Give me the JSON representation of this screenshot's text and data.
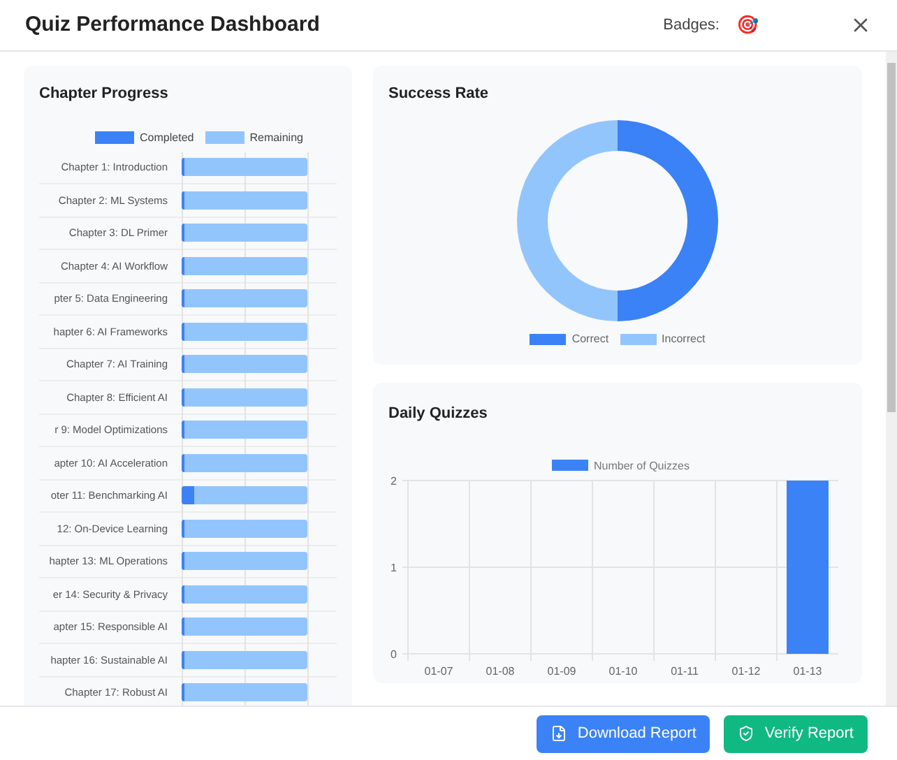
{
  "window": {
    "title": "Quiz Performance Dashboard",
    "badges_label": "Badges:",
    "badges": [
      "🎯"
    ]
  },
  "chapter_progress": {
    "title": "Chapter Progress",
    "legend": [
      {
        "label": "Completed",
        "color": "#3b82f6"
      },
      {
        "label": "Remaining",
        "color": "#93c5fd"
      }
    ],
    "chapters": [
      {
        "label": "Chapter 1: Introduction",
        "level": 0.02
      },
      {
        "label": "Chapter 2: ML Systems",
        "level": 0.02
      },
      {
        "label": "Chapter 3: DL Primer",
        "level": 0.02
      },
      {
        "label": "Chapter 4: AI Workflow",
        "level": 0.02
      },
      {
        "label": "pter 5: Data Engineering",
        "level": 0.02
      },
      {
        "label": "hapter 6: AI Frameworks",
        "level": 0.02
      },
      {
        "label": "Chapter 7: AI Training",
        "level": 0.02
      },
      {
        "label": "Chapter 8: Efficient AI",
        "level": 0.02
      },
      {
        "label": "r 9: Model Optimizations",
        "level": 0.02
      },
      {
        "label": "apter 10: AI Acceleration",
        "level": 0.02
      },
      {
        "label": "oter 11: Benchmarking AI",
        "level": 0.1
      },
      {
        "label": "12: On-Device Learning",
        "level": 0.02
      },
      {
        "label": "hapter 13: ML Operations",
        "level": 0.02
      },
      {
        "label": "er 14: Security & Privacy",
        "level": 0.02
      },
      {
        "label": "apter 15: Responsible AI",
        "level": 0.02
      },
      {
        "label": "hapter 16: Sustainable AI",
        "level": 0.02
      },
      {
        "label": "Chapter 17: Robust AI",
        "level": 0.02
      }
    ]
  },
  "success_rate": {
    "title": "Success Rate",
    "legend": [
      {
        "label": "Correct",
        "color": "#3b82f6"
      },
      {
        "label": "Incorrect",
        "color": "#93c5fd"
      }
    ]
  },
  "daily_quizzes": {
    "title": "Daily Quizzes",
    "chart_data": {
      "type": "bar",
      "categories": [
        "01-07",
        "01-08",
        "01-09",
        "01-10",
        "01-11",
        "01-12",
        "01-13"
      ],
      "series": [
        {
          "name": "Number of Quizzes",
          "color": "#3b82f6",
          "values": [
            0,
            0,
            0,
            0,
            0,
            0,
            2
          ]
        }
      ],
      "ylim": [
        0,
        2
      ],
      "yticks": [
        0,
        1,
        2
      ]
    }
  },
  "buttons": [
    {
      "label": "Download Report",
      "kind": "download"
    },
    {
      "label": "Verify Report",
      "kind": "verify"
    }
  ]
}
